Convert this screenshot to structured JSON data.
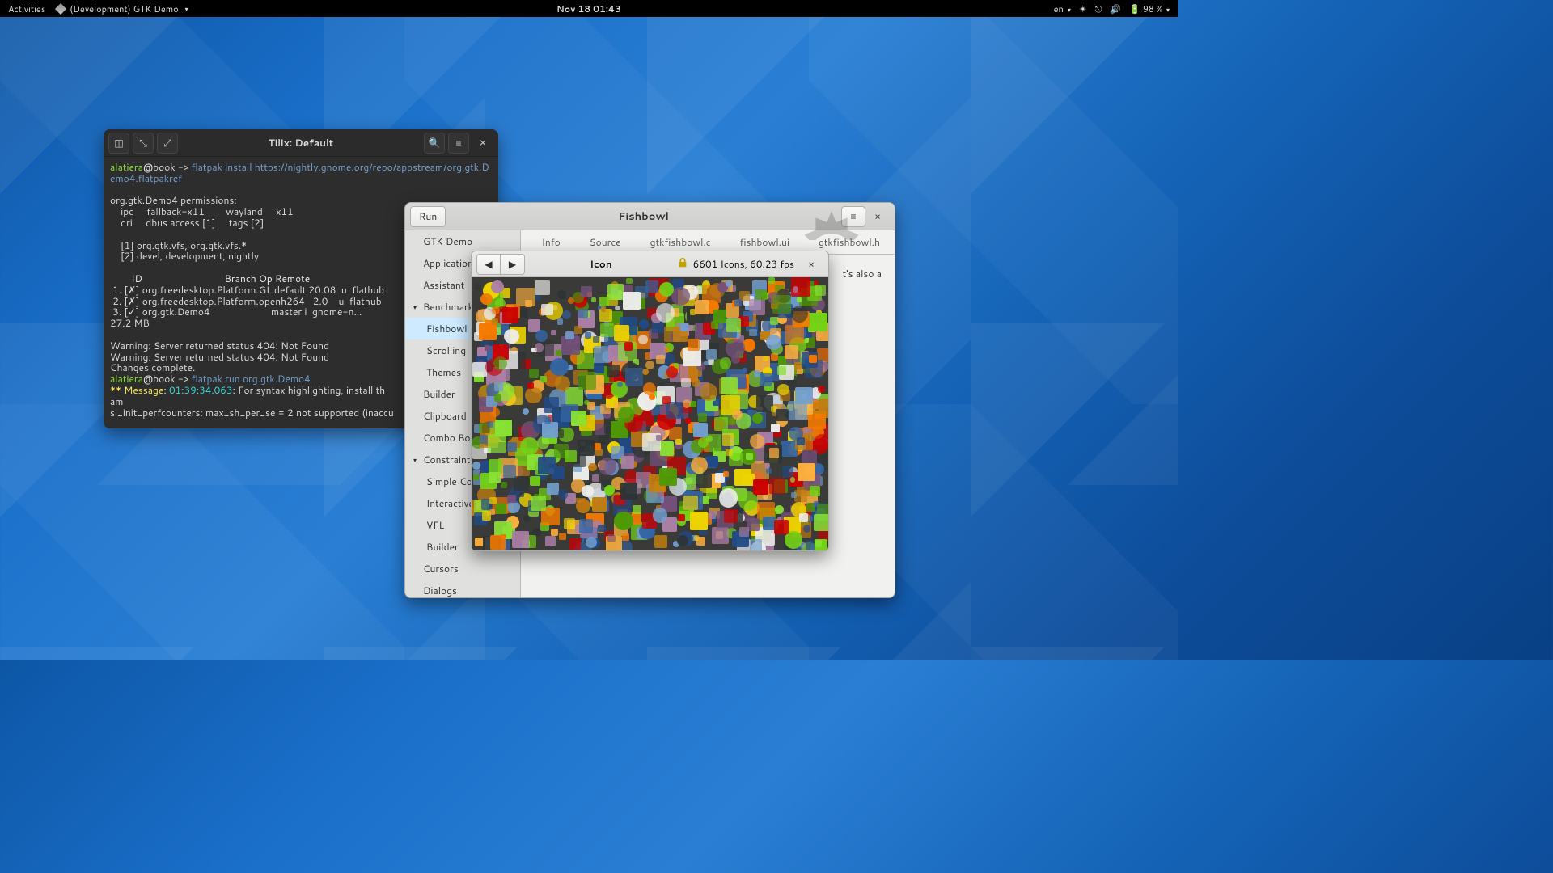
{
  "topbar": {
    "activities": "Activities",
    "app_menu": "(Development) GTK Demo",
    "clock": "Nov 18  01:43",
    "lang": "en",
    "battery": "98 %"
  },
  "tilix": {
    "title": "Tilix: Default",
    "prompt_user": "alatiera",
    "prompt_host": "book",
    "prompt_sep": " -> ",
    "cmd1": "flatpak install https://nightly.gnome.org/repo/appstream/org.gtk.Demo4.flatpakref",
    "perm_head": "org.gtk.Demo4 permissions:",
    "perm_l1": "    ipc     fallback-x11        wayland     x11",
    "perm_l2": "    dri     dbus access [1]     tags [2]",
    "perm_l3": "    [1] org.gtk.vfs, org.gtk.vfs.*",
    "perm_l4": "    [2] devel, development, nightly",
    "tbl_head": "        ID                               Branch Op Remote",
    "tbl_r1": " 1. [✗] org.freedesktop.Platform.GL.default 20.08  u  flathub",
    "tbl_r2": " 2. [✗] org.freedesktop.Platform.openh264   2.0    u  flathub",
    "tbl_r3": " 3. [✓] org.gtk.Demo4                       master i  gnome-n…",
    "size": "27.2 MB",
    "warn1": "Warning: Server returned status 404: Not Found",
    "warn2": "Warning: Server returned status 404: Not Found",
    "done": "Changes complete.",
    "cmd2": "flatpak run org.gtk.Demo4",
    "msg_label": "** Message",
    "msg_time": "01:39:34.063",
    "msg_rest": ": For syntax highlighting, install th",
    "am": "am",
    "perf": "si_init_perfcounters: max_sh_per_se = 2 not supported (inaccu"
  },
  "gtkdemo": {
    "run": "Run",
    "title": "Fishbowl",
    "sidebar": [
      {
        "label": "GTK Demo",
        "lvl": 0
      },
      {
        "label": "Application C",
        "lvl": 0
      },
      {
        "label": "Assistant",
        "lvl": 0
      },
      {
        "label": "Benchmark",
        "lvl": 0,
        "exp": true
      },
      {
        "label": "Fishbowl",
        "lvl": 1,
        "sel": true
      },
      {
        "label": "Scrolling",
        "lvl": 1
      },
      {
        "label": "Themes",
        "lvl": 1
      },
      {
        "label": "Builder",
        "lvl": 0
      },
      {
        "label": "Clipboard",
        "lvl": 0
      },
      {
        "label": "Combo Boxe",
        "lvl": 0
      },
      {
        "label": "Constraints",
        "lvl": 0,
        "exp": true
      },
      {
        "label": "Simple Co",
        "lvl": 1
      },
      {
        "label": "Interactive",
        "lvl": 1
      },
      {
        "label": "VFL",
        "lvl": 1
      },
      {
        "label": "Builder",
        "lvl": 1
      },
      {
        "label": "Cursors",
        "lvl": 0
      },
      {
        "label": "Dialogs",
        "lvl": 0
      }
    ],
    "tabs": [
      "Info",
      "Source",
      "gtkfishbowl.c",
      "fishbowl.ui",
      "gtkfishbowl.h"
    ],
    "info_text": "t's also a"
  },
  "fishbowl": {
    "title": "Icon",
    "stats": "6601 Icons, 60.23 fps"
  }
}
